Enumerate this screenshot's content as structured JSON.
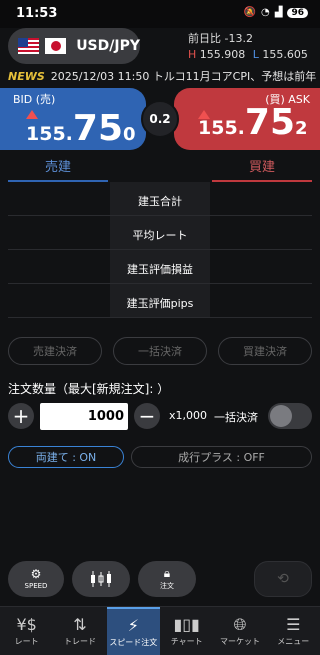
{
  "status": {
    "time": "11:53",
    "battery": "96"
  },
  "header": {
    "pair": "USD/JPY",
    "change_label": "前日比",
    "change_value": "-13.2",
    "high_label": "H",
    "high_value": "155.908",
    "low_label": "L",
    "low_value": "155.605"
  },
  "news": {
    "tag": "NEWS",
    "text": "2025/12/03 11:50 トルコ11月コアCPI、予想は前年"
  },
  "bid": {
    "label": "BID (売)",
    "p1": "155.",
    "p2": "75",
    "p3": "0"
  },
  "ask": {
    "label": "(買) ASK",
    "p1": "155.",
    "p2": "75",
    "p3": "2"
  },
  "spread": "0.2",
  "positions": {
    "sell_tab": "売建",
    "buy_tab": "買建",
    "rows": [
      "建玉合計",
      "平均レート",
      "建玉評価損益",
      "建玉評価pips"
    ]
  },
  "settle": {
    "sell": "売建決済",
    "all": "一括決済",
    "buy": "買建決済"
  },
  "order": {
    "qty_label": "注文数量（最大[新規注文]: ）",
    "plus": "+",
    "minus": "−",
    "qty_value": "1000",
    "multiplier": "x1,000",
    "bulk_label": "一括決済",
    "ryodate": "両建て : ON",
    "nariyuki": "成行プラス : OFF"
  },
  "fabs": {
    "speed": "SPEED",
    "chart_icon": "candlestick-icon",
    "order": "注文"
  },
  "nav": [
    {
      "label": "レート",
      "icon": "rate-icon"
    },
    {
      "label": "トレード",
      "icon": "trade-icon"
    },
    {
      "label": "スピード注文",
      "icon": "speed-order-icon"
    },
    {
      "label": "チャート",
      "icon": "chart-icon"
    },
    {
      "label": "マーケット",
      "icon": "market-icon"
    },
    {
      "label": "メニュー",
      "icon": "menu-icon"
    }
  ],
  "colors": {
    "bid": "#2f64b3",
    "ask": "#c0393e",
    "accent": "#3a83d6"
  }
}
